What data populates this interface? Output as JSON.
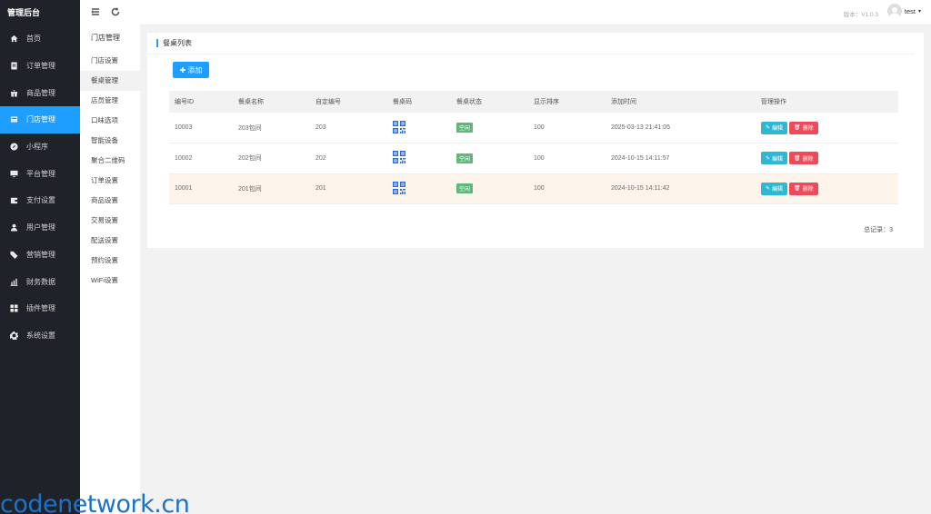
{
  "brand": "管理后台",
  "nav": [
    {
      "label": "首页",
      "icon": "home-icon"
    },
    {
      "label": "订单管理",
      "icon": "order-icon"
    },
    {
      "label": "商品管理",
      "icon": "gift-icon"
    },
    {
      "label": "门店管理",
      "icon": "store-icon"
    },
    {
      "label": "小程序",
      "icon": "compass-icon"
    },
    {
      "label": "平台管理",
      "icon": "monitor-icon"
    },
    {
      "label": "支付设置",
      "icon": "wallet-icon"
    },
    {
      "label": "用户管理",
      "icon": "user-icon"
    },
    {
      "label": "营销管理",
      "icon": "tag-icon"
    },
    {
      "label": "财务数据",
      "icon": "chart-icon"
    },
    {
      "label": "插件管理",
      "icon": "grid-icon"
    },
    {
      "label": "系统设置",
      "icon": "gear-icon"
    }
  ],
  "subnav": {
    "title": "门店管理",
    "items": [
      "门店设置",
      "餐桌管理",
      "店员管理",
      "口味选项",
      "智能设备",
      "聚合二维码",
      "订单设置",
      "商品设置",
      "交易设置",
      "配送设置",
      "预约设置",
      "WiFi设置"
    ]
  },
  "header": {
    "version": "版本：V1.0.3",
    "username": "test"
  },
  "card": {
    "title": "餐桌列表",
    "add_label": "添加",
    "columns": [
      "编号ID",
      "餐桌名称",
      "自定编号",
      "餐桌码",
      "餐桌状态",
      "显示排序",
      "添加时间",
      "管理操作"
    ],
    "rows": [
      {
        "id": "10003",
        "name": "203包间",
        "code": "203",
        "status": "空闲",
        "sort": "100",
        "time": "2025-03-13 21:41:05"
      },
      {
        "id": "10002",
        "name": "202包间",
        "code": "202",
        "status": "空闲",
        "sort": "100",
        "time": "2024-10-15 14:11:57"
      },
      {
        "id": "10001",
        "name": "201包间",
        "code": "201",
        "status": "空闲",
        "sort": "100",
        "time": "2024-10-15 14:11:42"
      }
    ],
    "edit_label": "编辑",
    "delete_label": "删除",
    "total": "总记录：3"
  },
  "watermark": "codenetwork.cn",
  "colors": {
    "accent": "#1e9fff",
    "sidebar": "#20222a",
    "edit": "#2fb8d3",
    "delete": "#ef4a5a",
    "status": "#5fb878"
  }
}
